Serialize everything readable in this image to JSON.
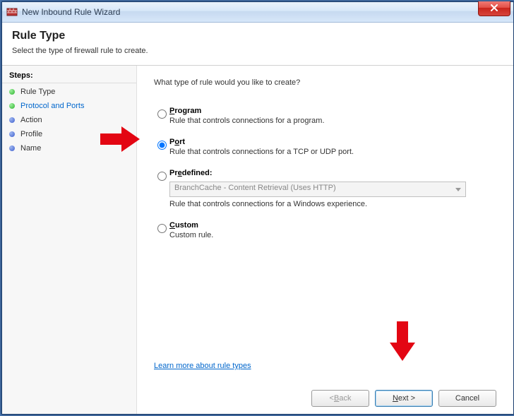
{
  "window": {
    "title": "New Inbound Rule Wizard"
  },
  "header": {
    "title": "Rule Type",
    "subtitle": "Select the type of firewall rule to create."
  },
  "sidebar": {
    "title": "Steps:",
    "items": [
      {
        "label": "Rule Type",
        "bullet": "green",
        "active": false
      },
      {
        "label": "Protocol and Ports",
        "bullet": "green",
        "active": true
      },
      {
        "label": "Action",
        "bullet": "blue",
        "active": false
      },
      {
        "label": "Profile",
        "bullet": "blue",
        "active": false
      },
      {
        "label": "Name",
        "bullet": "blue",
        "active": false
      }
    ]
  },
  "main": {
    "prompt": "What type of rule would you like to create?",
    "options": {
      "program": {
        "label": "Program",
        "desc": "Rule that controls connections for a program.",
        "selected": false
      },
      "port": {
        "label": "Port",
        "desc": "Rule that controls connections for a TCP or UDP port.",
        "selected": true
      },
      "predefined": {
        "label": "Predefined:",
        "select_value": "BranchCache - Content Retrieval (Uses HTTP)",
        "desc": "Rule that controls connections for a Windows experience.",
        "selected": false
      },
      "custom": {
        "label": "Custom",
        "desc": "Custom rule.",
        "selected": false
      }
    },
    "learn_link": "Learn more about rule types"
  },
  "buttons": {
    "back": "< Back",
    "next": "Next >",
    "cancel": "Cancel"
  }
}
